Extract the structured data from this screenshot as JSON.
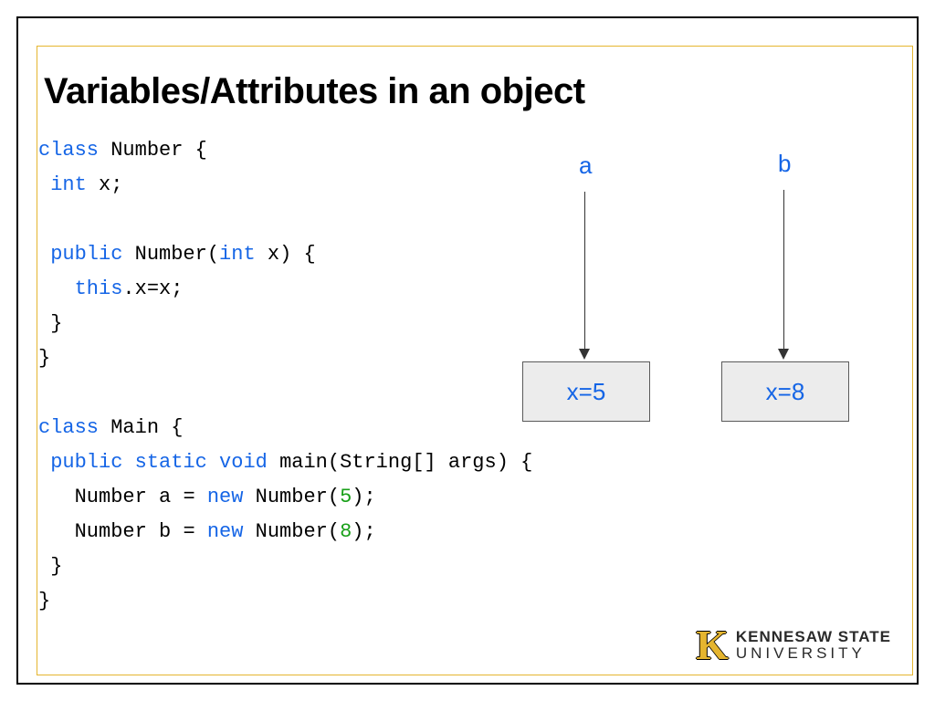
{
  "title": "Variables/Attributes in an object",
  "code": {
    "kw_class": "class",
    "kw_int": "int",
    "kw_public": "public",
    "kw_this": "this",
    "kw_static": "static",
    "kw_void": "void",
    "kw_new": "new",
    "name_number": "Number",
    "field_x": "x",
    "name_main_class": "Main",
    "name_main_method": "main",
    "args_type": "String[] args",
    "var_a": "a",
    "var_b": "b",
    "lit_5": "5",
    "lit_8": "8",
    "brace_open": "{",
    "brace_close": "}",
    "semicolon": ";",
    "paren_open": "(",
    "paren_close": ")",
    "dot": ".",
    "eq": "=",
    "sp": " "
  },
  "diagram": {
    "label_a": "a",
    "label_b": "b",
    "box_a": "x=5",
    "box_b": "x=8"
  },
  "logo": {
    "glyph": "K",
    "line1": "KENNESAW STATE",
    "line2": "UNIVERSITY"
  }
}
